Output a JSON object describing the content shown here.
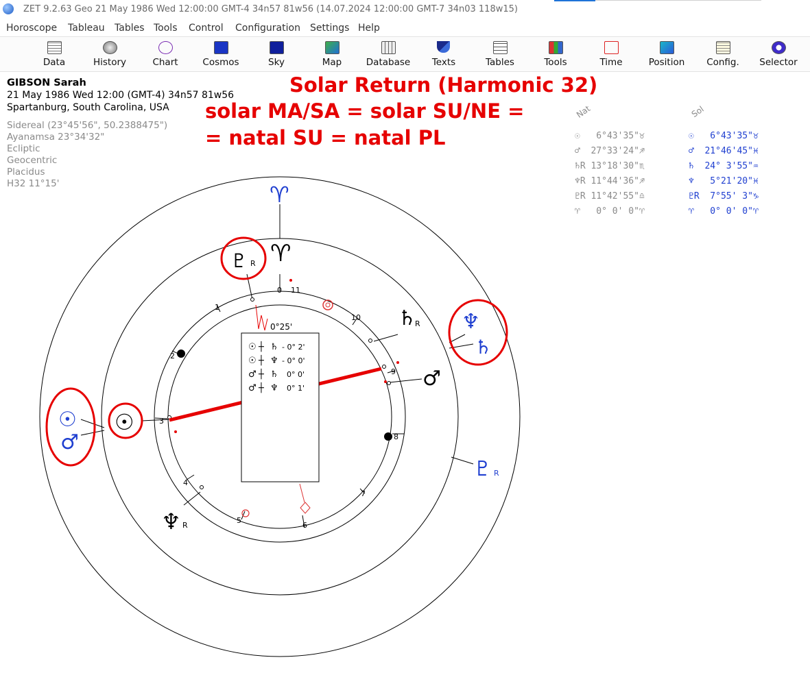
{
  "window": {
    "title": "ZET 9.2.63 Geo   21 May 1986  Wed  12:00:00 GMT-4 34n57  81w56  (14.07.2024  12:00:00 GMT-7 34n03 118w15)"
  },
  "menu": [
    "Horoscope",
    "Tableau",
    "Tables",
    "Tools",
    "Control",
    "Configuration",
    "Settings",
    "Help"
  ],
  "toolbar": [
    {
      "label": "Data",
      "icon": "data-table-icon"
    },
    {
      "label": "History",
      "icon": "history-disc-icon"
    },
    {
      "label": "Chart",
      "icon": "chart-wheel-icon"
    },
    {
      "label": "Cosmos",
      "icon": "cosmos-icon"
    },
    {
      "label": "Sky",
      "icon": "sky-icon"
    },
    {
      "label": "Map",
      "icon": "map-icon"
    },
    {
      "label": "Database",
      "icon": "database-icon"
    },
    {
      "label": "Texts",
      "icon": "texts-icon"
    },
    {
      "label": "Tables",
      "icon": "tables-icon"
    },
    {
      "label": "Tools",
      "icon": "tools-icon"
    },
    {
      "label": "Time",
      "icon": "time-icon"
    },
    {
      "label": "Position",
      "icon": "position-icon"
    },
    {
      "label": "Config.",
      "icon": "config-icon"
    },
    {
      "label": "Selector",
      "icon": "selector-icon"
    }
  ],
  "person": {
    "name": "GIBSON Sarah",
    "datetime": "21 May 1986  Wed  12:00 (GMT-4) 34n57  81w56",
    "place": "Spartanburg, South Carolina, USA",
    "settings": [
      "Sidereal (23°45'56\", 50.2388475\")",
      "Ayanamsa 23°34'32\"",
      "Ecliptic",
      "Geocentric",
      "Placidus",
      "H32  11°15'"
    ]
  },
  "annotation": {
    "title": "Solar Return (Harmonic 32)",
    "line1": "solar MA/SA = solar SU/NE =",
    "line2": "= natal SU = natal PL",
    "color": "#e60000"
  },
  "legend": {
    "nat_header": "Nat",
    "sol_header": "Sol",
    "nat": [
      {
        "glyph": "☉",
        "retro": "",
        "pos": " 6°43'35\"",
        "sign": "♉"
      },
      {
        "glyph": "♂",
        "retro": "",
        "pos": "27°33'24\"",
        "sign": "♐"
      },
      {
        "glyph": "♄",
        "retro": "R",
        "pos": "13°18'30\"",
        "sign": "♏"
      },
      {
        "glyph": "♆",
        "retro": "R",
        "pos": "11°44'36\"",
        "sign": "♐"
      },
      {
        "glyph": "♇",
        "retro": "R",
        "pos": "11°42'55\"",
        "sign": "♎"
      },
      {
        "glyph": "♈",
        "retro": "",
        "pos": " 0° 0' 0\"",
        "sign": "♈"
      }
    ],
    "sol": [
      {
        "glyph": "☉",
        "retro": "",
        "pos": " 6°43'35\"",
        "sign": "♉"
      },
      {
        "glyph": "♂",
        "retro": "",
        "pos": "21°46'45\"",
        "sign": "♓"
      },
      {
        "glyph": "♄",
        "retro": "",
        "pos": "24° 3'55\"",
        "sign": "♒"
      },
      {
        "glyph": "♆",
        "retro": "",
        "pos": " 5°21'20\"",
        "sign": "♓"
      },
      {
        "glyph": "♇",
        "retro": "R",
        "pos": " 7°55' 3\"",
        "sign": "♑"
      },
      {
        "glyph": "♈",
        "retro": "",
        "pos": " 0° 0' 0\"",
        "sign": "♈"
      }
    ],
    "nat_color": "#8a8a8a",
    "sol_color": "#1f3fd0"
  },
  "chart": {
    "aspect_box": [
      {
        "a": "☉",
        "b": "♄",
        "val": "- 0° 2'"
      },
      {
        "a": "☉",
        "b": "♆",
        "val": "- 0° 0'"
      },
      {
        "a": "♂",
        "b": "♄",
        "val": "0° 0'"
      },
      {
        "a": "♂",
        "b": "♆",
        "val": "0° 1'"
      }
    ],
    "midpoint_label": "0°25'",
    "house_numbers": [
      "0",
      "11",
      "1",
      "10",
      "2",
      "9",
      "3",
      "8",
      "4",
      "7",
      "5",
      "6"
    ],
    "natal_planets": {
      "sun": "☉",
      "mars": "♂",
      "saturn": "♄",
      "neptune": "♆",
      "pluto": "♇",
      "aries": "♈",
      "retro": "R"
    },
    "solar_planets": {
      "sun": "☉",
      "mars": "♂",
      "saturn": "♄",
      "neptune": "♆",
      "pluto": "♇",
      "aries": "♈",
      "retro": "R"
    },
    "colors": {
      "solar": "#1f3fd0",
      "natal": "#000000",
      "highlight": "#e60000"
    }
  }
}
